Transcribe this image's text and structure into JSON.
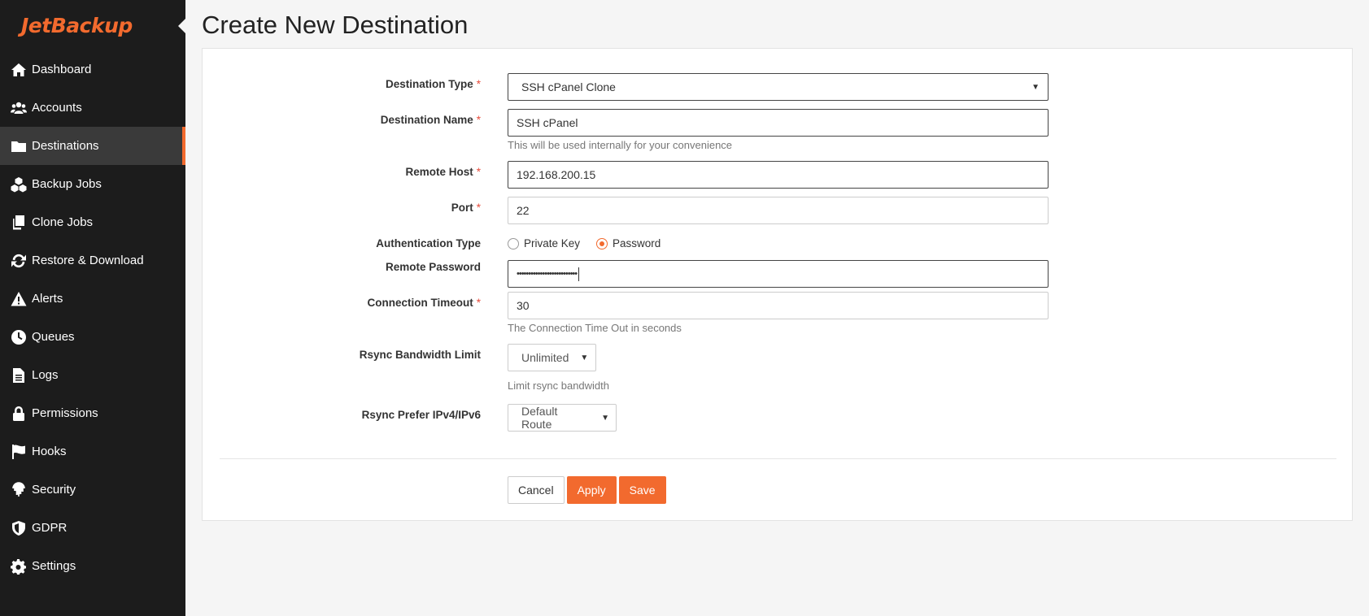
{
  "app": {
    "logo": "JetBackup"
  },
  "sidebar": {
    "items": [
      {
        "label": "Dashboard",
        "icon": "home-icon"
      },
      {
        "label": "Accounts",
        "icon": "users-icon"
      },
      {
        "label": "Destinations",
        "icon": "folder-icon",
        "active": true
      },
      {
        "label": "Backup Jobs",
        "icon": "cubes-icon"
      },
      {
        "label": "Clone Jobs",
        "icon": "copy-icon"
      },
      {
        "label": "Restore & Download",
        "icon": "refresh-icon"
      },
      {
        "label": "Alerts",
        "icon": "warning-icon"
      },
      {
        "label": "Queues",
        "icon": "clock-icon"
      },
      {
        "label": "Logs",
        "icon": "file-icon"
      },
      {
        "label": "Permissions",
        "icon": "lock-icon"
      },
      {
        "label": "Hooks",
        "icon": "flag-icon"
      },
      {
        "label": "Security",
        "icon": "fingerprint-icon"
      },
      {
        "label": "GDPR",
        "icon": "shield-icon"
      },
      {
        "label": "Settings",
        "icon": "gear-icon"
      }
    ]
  },
  "page": {
    "title": "Create New Destination"
  },
  "form": {
    "destination_type": {
      "label": "Destination Type",
      "value": "SSH cPanel Clone"
    },
    "destination_name": {
      "label": "Destination Name",
      "value": "SSH cPanel",
      "help": "This will be used internally for your convenience"
    },
    "remote_host": {
      "label": "Remote Host",
      "value": "192.168.200.15"
    },
    "port": {
      "label": "Port",
      "value": "22"
    },
    "auth_type": {
      "label": "Authentication Type",
      "options": [
        "Private Key",
        "Password"
      ],
      "selected": "Password"
    },
    "remote_password": {
      "label": "Remote Password",
      "value": "••••••••••••••••••••••••••"
    },
    "connection_timeout": {
      "label": "Connection Timeout",
      "value": "30",
      "help": "The Connection Time Out in seconds"
    },
    "rsync_bandwidth": {
      "label": "Rsync Bandwidth Limit",
      "value": "Unlimited",
      "help": "Limit rsync bandwidth"
    },
    "rsync_prefer": {
      "label": "Rsync Prefer IPv4/IPv6",
      "value": "Default Route"
    },
    "required_marker": "*"
  },
  "actions": {
    "cancel": "Cancel",
    "apply": "Apply",
    "save": "Save"
  },
  "colors": {
    "accent": "#f26a2e",
    "sidebar_bg": "#1c1c1c",
    "required": "#e74c3c"
  }
}
